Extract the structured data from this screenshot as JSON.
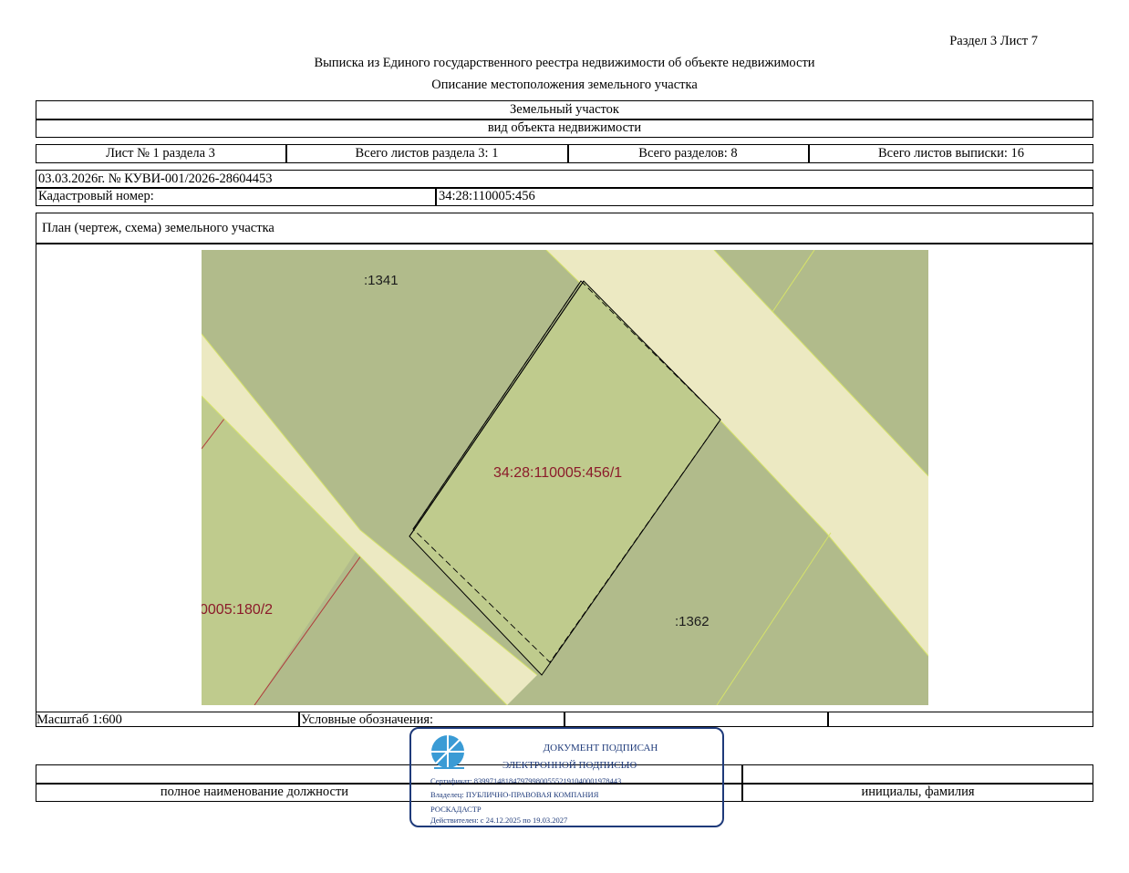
{
  "header": {
    "section_sheet": "Раздел 3    Лист 7",
    "title": "Выписка из Единого государственного реестра недвижимости об объекте недвижимости",
    "subtitle": "Описание местоположения земельного участка"
  },
  "object": {
    "type_value": "Земельный участок",
    "type_caption": "вид объекта недвижимости"
  },
  "sheet_info": {
    "sheet": "Лист № 1 раздела 3",
    "total_sheets_section": "Всего листов раздела 3: 1",
    "total_sections": "Всего разделов: 8",
    "total_sheets_extract": "Всего листов выписки: 16"
  },
  "record": {
    "date_number": "03.03.2026г. № КУВИ-001/2026-28604453",
    "cadastral_label": "Кадастровый номер:",
    "cadastral_value": "34:28:110005:456"
  },
  "plan": {
    "title": "План (чертеж, схема) земельного участка",
    "labels": {
      "parcel_1341": ":1341",
      "parcel_main": "34:28:110005:456/1",
      "parcel_180": "0005:180/2",
      "parcel_1362": ":1362"
    },
    "colors": {
      "dark_parcel": "#b1bb8b",
      "light_parcel": "#bfcb8d",
      "road": "#ece9c2",
      "label_red": "#8b1a2a"
    }
  },
  "footer": {
    "scale": "Масштаб 1:600",
    "legend": "Условные обозначения:",
    "position_caption": "полное наименование должности",
    "initials_caption": "инициалы, фамилия"
  },
  "stamp": {
    "line1": "ДОКУМЕНТ ПОДПИСАН",
    "line2": "ЭЛЕКТРОННОЙ ПОДПИСЬЮ",
    "certificate": "Сертификат: 83997148184797998005552191040001978443",
    "owner_line1": "Владелец: ПУБЛИЧНО-ПРАВОВАЯ КОМПАНИЯ",
    "owner_line2": "РОСКАДАСТР",
    "valid": "Действителен: с 24.12.2025 по 19.03.2027",
    "color": "#1e3a7a"
  }
}
